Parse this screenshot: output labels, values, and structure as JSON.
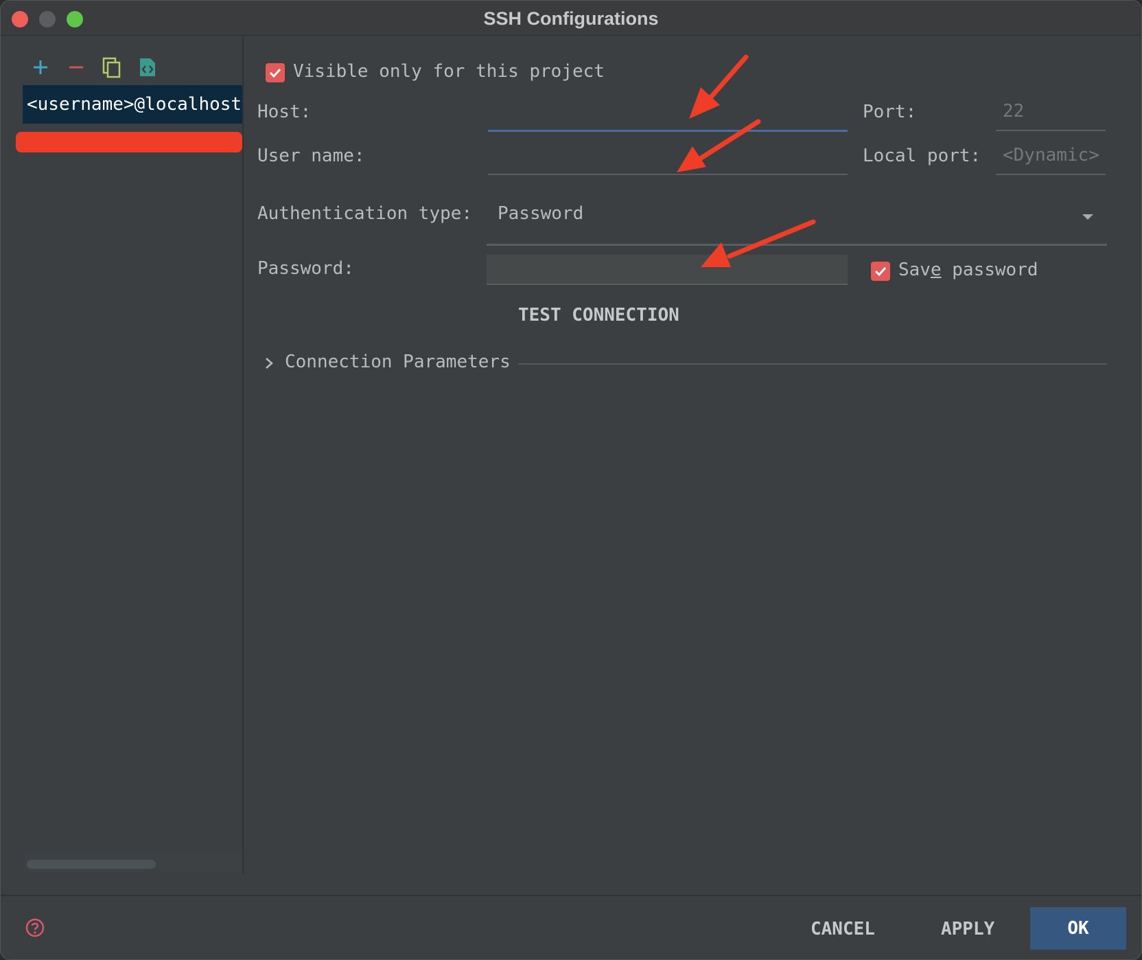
{
  "window": {
    "title": "SSH Configurations"
  },
  "sidebar": {
    "tools": [
      "add-icon",
      "remove-icon",
      "copy-icon",
      "export-icon"
    ],
    "items": [
      {
        "label": "<username>@localhost"
      }
    ]
  },
  "form": {
    "visible_only_label": "Visible only for this project",
    "host_label": "Host:",
    "host_value": "",
    "port_label": "Port:",
    "port_value": "22",
    "username_label": "User name:",
    "username_value": "",
    "local_port_label": "Local port:",
    "local_port_placeholder": "<Dynamic>",
    "auth_type_label": "Authentication type:",
    "auth_type_value": "Password",
    "password_label": "Password:",
    "password_value": "",
    "save_password_pre": "Sav",
    "save_password_mnemonic": "e",
    "save_password_post": " password",
    "test_connection": "TEST CONNECTION",
    "connection_params": "Connection Parameters"
  },
  "footer": {
    "cancel": "CANCEL",
    "apply": "APPLY",
    "ok": "OK"
  },
  "colors": {
    "accent": "#365880",
    "checkbox": "#e25a5a",
    "annotation": "#ee3e27"
  }
}
